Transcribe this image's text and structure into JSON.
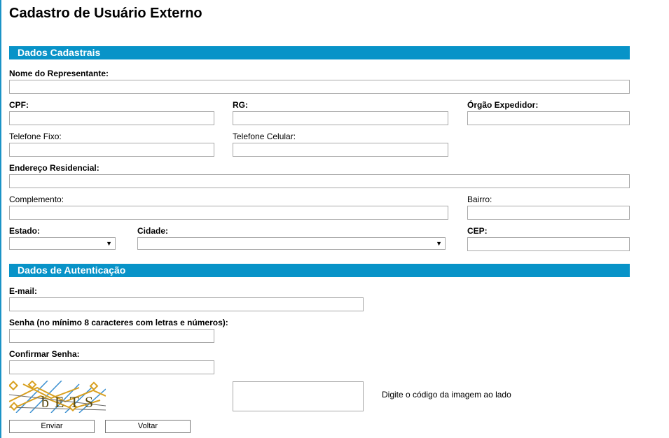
{
  "page": {
    "title": "Cadastro de Usuário Externo"
  },
  "sections": {
    "cadastrais": "Dados Cadastrais",
    "autenticacao": "Dados de Autenticação"
  },
  "fields": {
    "nome_representante": {
      "label": "Nome do Representante:",
      "value": ""
    },
    "cpf": {
      "label": "CPF:",
      "value": ""
    },
    "rg": {
      "label": "RG:",
      "value": ""
    },
    "orgao_expedidor": {
      "label": "Órgão Expedidor:",
      "value": ""
    },
    "telefone_fixo": {
      "label": "Telefone Fixo:",
      "value": ""
    },
    "telefone_celular": {
      "label": "Telefone Celular:",
      "value": ""
    },
    "endereco_residencial": {
      "label": "Endereço Residencial:",
      "value": ""
    },
    "complemento": {
      "label": "Complemento:",
      "value": ""
    },
    "bairro": {
      "label": "Bairro:",
      "value": ""
    },
    "estado": {
      "label": "Estado:",
      "selected": ""
    },
    "cidade": {
      "label": "Cidade:",
      "selected": ""
    },
    "cep": {
      "label": "CEP:",
      "value": ""
    },
    "email": {
      "label": "E-mail:",
      "value": ""
    },
    "senha": {
      "label": "Senha (no mínimo 8 caracteres com letras e números):",
      "value": ""
    },
    "confirmar_senha": {
      "label": "Confirmar Senha:",
      "value": ""
    }
  },
  "captcha": {
    "image_text": "bETS",
    "hint": "Digite o código da imagem ao lado",
    "value": ""
  },
  "buttons": {
    "enviar": "Enviar",
    "voltar": "Voltar"
  },
  "colors": {
    "section_bar": "#0893c8",
    "left_border": "#1b93c6"
  },
  "icons": {
    "dropdown": "caret-down-icon"
  }
}
